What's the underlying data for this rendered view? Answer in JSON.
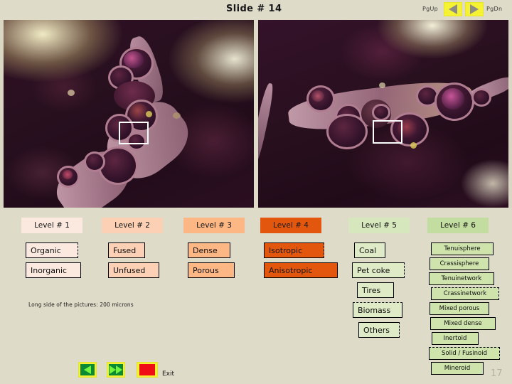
{
  "header": {
    "title": "Slide  # 14",
    "pgup_label": "PgUp",
    "pgdn_label": "PgDn",
    "prev_icon": "triangle-left-icon",
    "next_icon": "triangle-right-icon"
  },
  "micrographs": [
    {
      "name": "micrograph-left",
      "selection": "white-rectangle"
    },
    {
      "name": "micrograph-right",
      "selection": "white-rectangle"
    }
  ],
  "scale_note": "Long side of the pictures: 200 microns",
  "columns": [
    {
      "header": "Level # 1",
      "header_color": "#fbe9e0",
      "cell_color": "#fbe9e0",
      "items": [
        {
          "label": "Organic",
          "dashed": "right"
        },
        {
          "label": "Inorganic",
          "dashed": "none"
        }
      ]
    },
    {
      "header": "Level # 2",
      "header_color": "#fbd0b4",
      "cell_color": "#fbd0b4",
      "items": [
        {
          "label": "Fused",
          "dashed": "none"
        },
        {
          "label": "Unfused",
          "dashed": "none"
        }
      ]
    },
    {
      "header": "Level # 3",
      "header_color": "#fcb784",
      "cell_color": "#fcb784",
      "items": [
        {
          "label": "Dense",
          "dashed": "none"
        },
        {
          "label": "Porous",
          "dashed": "none"
        }
      ]
    },
    {
      "header": "Level # 4",
      "header_color": "#e2560d",
      "cell_color": "#e2560d",
      "items": [
        {
          "label": "Isotropic",
          "dashed": "right"
        },
        {
          "label": "Anisotropic",
          "dashed": "none"
        }
      ]
    },
    {
      "header": "Level # 5",
      "header_color": "#d6e7bd",
      "cell_color": "#dfeac6",
      "items": [
        {
          "label": "Coal",
          "dashed": "none"
        },
        {
          "label": "Pet coke",
          "dashed": "right"
        },
        {
          "label": "Tires",
          "dashed": "none"
        },
        {
          "label": "Biomass",
          "dashed": "top"
        },
        {
          "label": "Others",
          "dashed": "right"
        }
      ]
    },
    {
      "header": "Level # 6",
      "header_color": "#c3dda0",
      "cell_color": "#cfe3ad",
      "items": [
        {
          "label": "Tenuisphere",
          "dashed": "none"
        },
        {
          "label": "Crassisphere",
          "dashed": "none"
        },
        {
          "label": "Tenuinetwork",
          "dashed": "none"
        },
        {
          "label": "Crassinetwork",
          "dashed": "right-top"
        },
        {
          "label": "Mixed porous",
          "dashed": "none"
        },
        {
          "label": "Mixed dense",
          "dashed": "none"
        },
        {
          "label": "Inertoid",
          "dashed": "none"
        },
        {
          "label": "Solid / Fusinoid",
          "dashed": "right-top"
        },
        {
          "label": "Mineroid",
          "dashed": "none"
        }
      ]
    }
  ],
  "footer": {
    "prev_icon": "triangle-left-icon",
    "next_icon": "fast-forward-icon",
    "exit_icon": "stop-square-icon",
    "exit_label": "Exit",
    "page_number": "17"
  },
  "colors": {
    "background": "#dedbc8",
    "button_yellow": "#f4f233",
    "accent_orange": "#e2560d",
    "accent_green": "#0a8a34",
    "exit_red": "#ee0e13"
  }
}
